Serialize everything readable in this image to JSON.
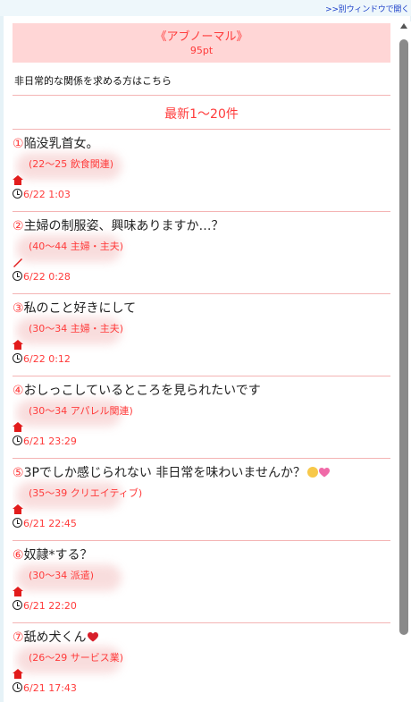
{
  "top_link": ">>別ウィンドウで開く",
  "header": {
    "title": "《アブノーマル》",
    "points": "95pt"
  },
  "description": "非日常的な関係を求める方はこちら",
  "section_title": "最新1〜20件",
  "posts": [
    {
      "num": "①",
      "title": "陥没乳首女。",
      "meta": "(22〜25 飲食関連)",
      "time": "6/22 1:03"
    },
    {
      "num": "②",
      "title": "主婦の制服姿、興味ありますか…？",
      "meta": "(40〜44 主婦・主夫)",
      "time": "6/22 0:28"
    },
    {
      "num": "③",
      "title": "私のこと好きにして",
      "meta": "(30〜34 主婦・主夫)",
      "time": "6/22 0:12"
    },
    {
      "num": "④",
      "title": "おしっこしているところを見られたいです",
      "meta": "(30〜34 アパレル関連)",
      "time": "6/21 23:29"
    },
    {
      "num": "⑤",
      "title": "3Pでしか感じられない 非日常を味わいませんか？",
      "meta": "(35〜39 クリエイティブ)",
      "time": "6/21 22:45"
    },
    {
      "num": "⑥",
      "title": "奴隷*する？",
      "meta": "(30〜34 派遣)",
      "time": "6/21 22:20"
    },
    {
      "num": "⑦",
      "title": "舐め犬くん",
      "meta": "(26〜29 サービス業)",
      "time": "6/21 17:43"
    }
  ],
  "colors": {
    "accent": "#ff3b3b",
    "header_bg": "#ffd6d6",
    "divider": "#f4b4b4",
    "page_bg": "#e6f2f7"
  },
  "icons": {
    "home": "home-icon",
    "clock": "clock-icon",
    "emoji": "smiley-face-icon",
    "heart": "heart-icon"
  }
}
